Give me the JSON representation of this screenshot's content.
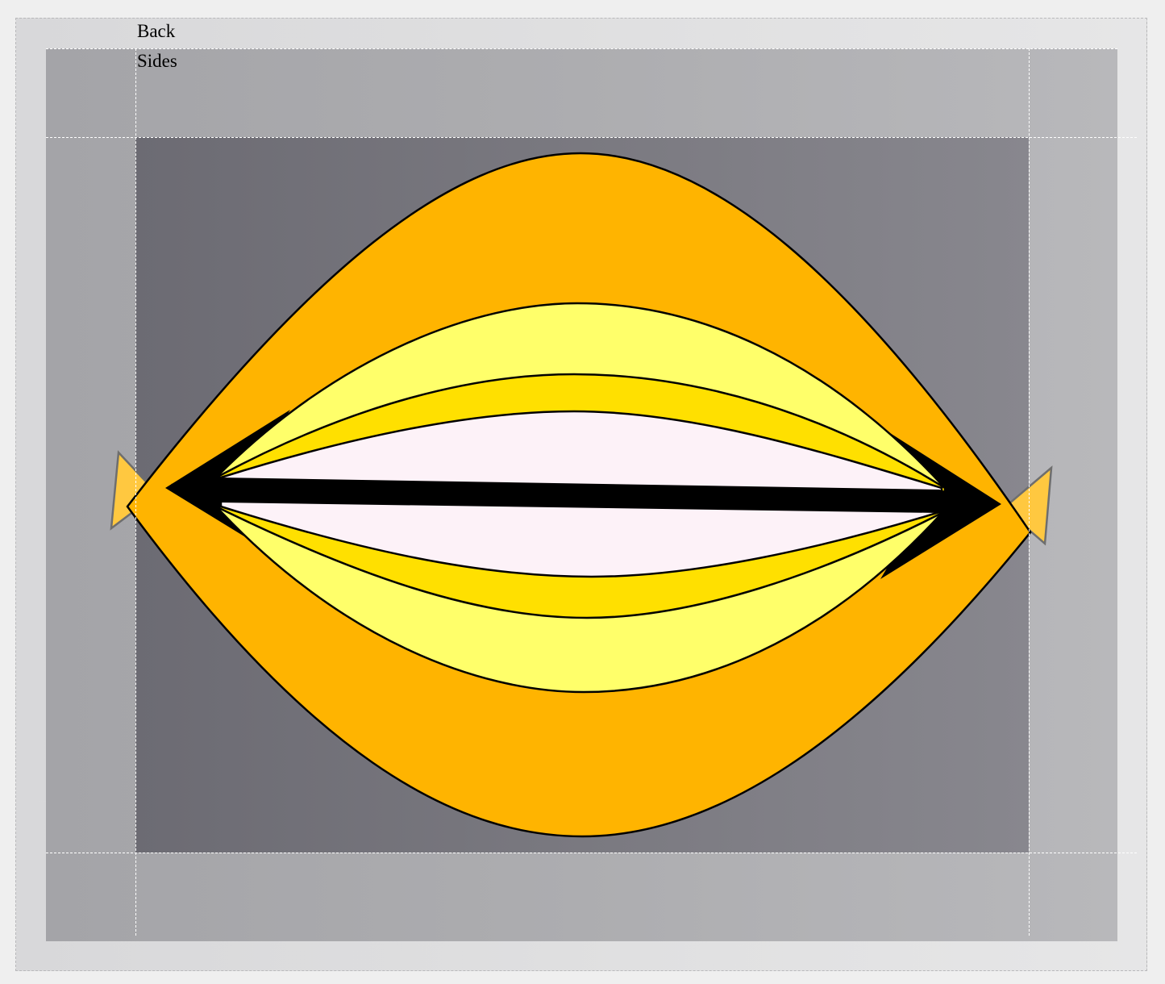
{
  "labels": {
    "back": "Back",
    "sides": "Sides"
  },
  "colors": {
    "outer_background": "#e0e0e1",
    "middle_background": "#adadb0",
    "inner_background": "#7a7980",
    "outer_shape": "#ffb400",
    "pale_yellow": "#ffff6a",
    "gold": "#ffe000",
    "center_fill": "#fdf2f8",
    "axis_bar": "#000000",
    "guide_line": "#ffffff"
  }
}
